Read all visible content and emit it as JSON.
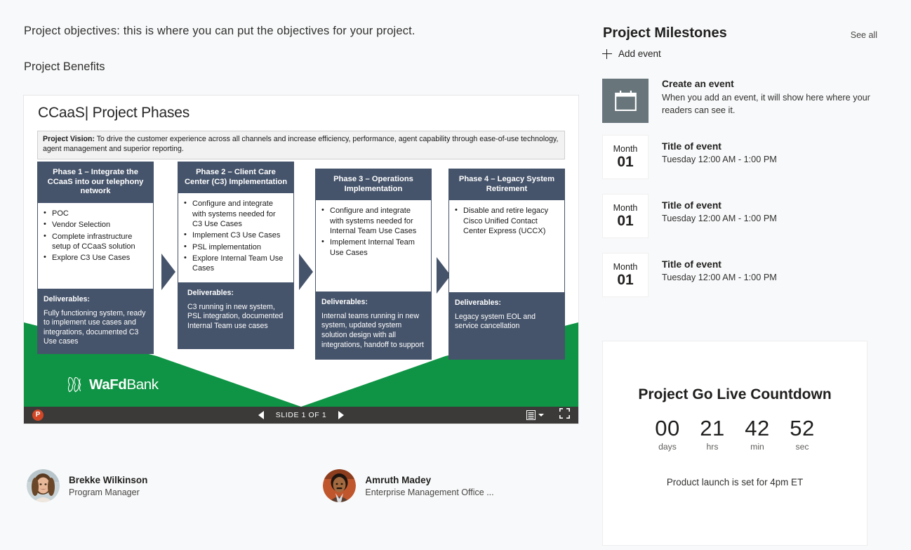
{
  "left": {
    "objectives_text": "Project objectives: this is where you can put the objectives for your project.",
    "benefits_text": "Project Benefits"
  },
  "slide": {
    "title": "CCaaS| Project Phases",
    "vision_label": "Project Vision:",
    "vision_text": " To drive the customer experience across all channels and increase efficiency, performance, agent capability through ease-of-use technology, agent management and superior reporting.",
    "deliverables_label": "Deliverables:",
    "phases": [
      {
        "heading": "Phase 1 – Integrate the CCaaS into our telephony network",
        "bullets": [
          "POC",
          "Vendor Selection",
          "Complete infrastructure setup of CCaaS solution",
          "Explore C3 Use Cases"
        ],
        "deliverables": "Fully functioning system, ready to implement use cases and integrations, documented C3 Use cases"
      },
      {
        "heading": "Phase 2 – Client Care Center (C3) Implementation",
        "bullets": [
          "Configure and integrate with systems needed for C3 Use Cases",
          "Implement C3 Use Cases",
          "PSL implementation",
          "Explore Internal Team Use Cases"
        ],
        "deliverables": "C3 running in new system, PSL integration, documented Internal Team use cases"
      },
      {
        "heading": "Phase 3 – Operations Implementation",
        "bullets": [
          "Configure and integrate with systems needed for Internal Team Use Cases",
          "Implement Internal Team Use Cases"
        ],
        "deliverables": "Internal teams running in new system, updated system solution design with all integrations, handoff to support"
      },
      {
        "heading": "Phase 4 – Legacy System Retirement",
        "bullets": [
          "Disable and retire legacy Cisco Unified Contact Center Express (UCCX)"
        ],
        "deliverables": "Legacy system EOL and service cancellation"
      }
    ],
    "logo": {
      "bold": "WaFd",
      "light": "Bank"
    },
    "colors": {
      "navy": "#46546b",
      "green": "#0e9444",
      "vision_bg": "#f2f2f2"
    }
  },
  "ppt_bar": {
    "app_glyph": "P",
    "slide_counter": "SLIDE 1 OF 1",
    "prev_label": "previous-slide",
    "next_label": "next-slide",
    "notes_label": "notes",
    "fullscreen_label": "fullscreen"
  },
  "people": [
    {
      "name": "Brekke Wilkinson",
      "role": "Program Manager"
    },
    {
      "name": "Amruth Madey",
      "role": "Enterprise Management Office ..."
    }
  ],
  "milestones": {
    "title": "Project Milestones",
    "see_all": "See all",
    "add_event": "Add event",
    "create": {
      "title": "Create an event",
      "description": "When you add an event, it will show here where your readers can see it."
    },
    "events": [
      {
        "month": "Month",
        "day": "01",
        "title": "Title of event",
        "time": "Tuesday 12:00 AM - 1:00 PM"
      },
      {
        "month": "Month",
        "day": "01",
        "title": "Title of event",
        "time": "Tuesday 12:00 AM - 1:00 PM"
      },
      {
        "month": "Month",
        "day": "01",
        "title": "Title of event",
        "time": "Tuesday 12:00 AM - 1:00 PM"
      }
    ]
  },
  "countdown": {
    "title": "Project Go Live Countdown",
    "units": [
      {
        "value": "00",
        "label": "days"
      },
      {
        "value": "21",
        "label": "hrs"
      },
      {
        "value": "42",
        "label": "min"
      },
      {
        "value": "52",
        "label": "sec"
      }
    ],
    "note": "Product launch is set for 4pm ET"
  }
}
